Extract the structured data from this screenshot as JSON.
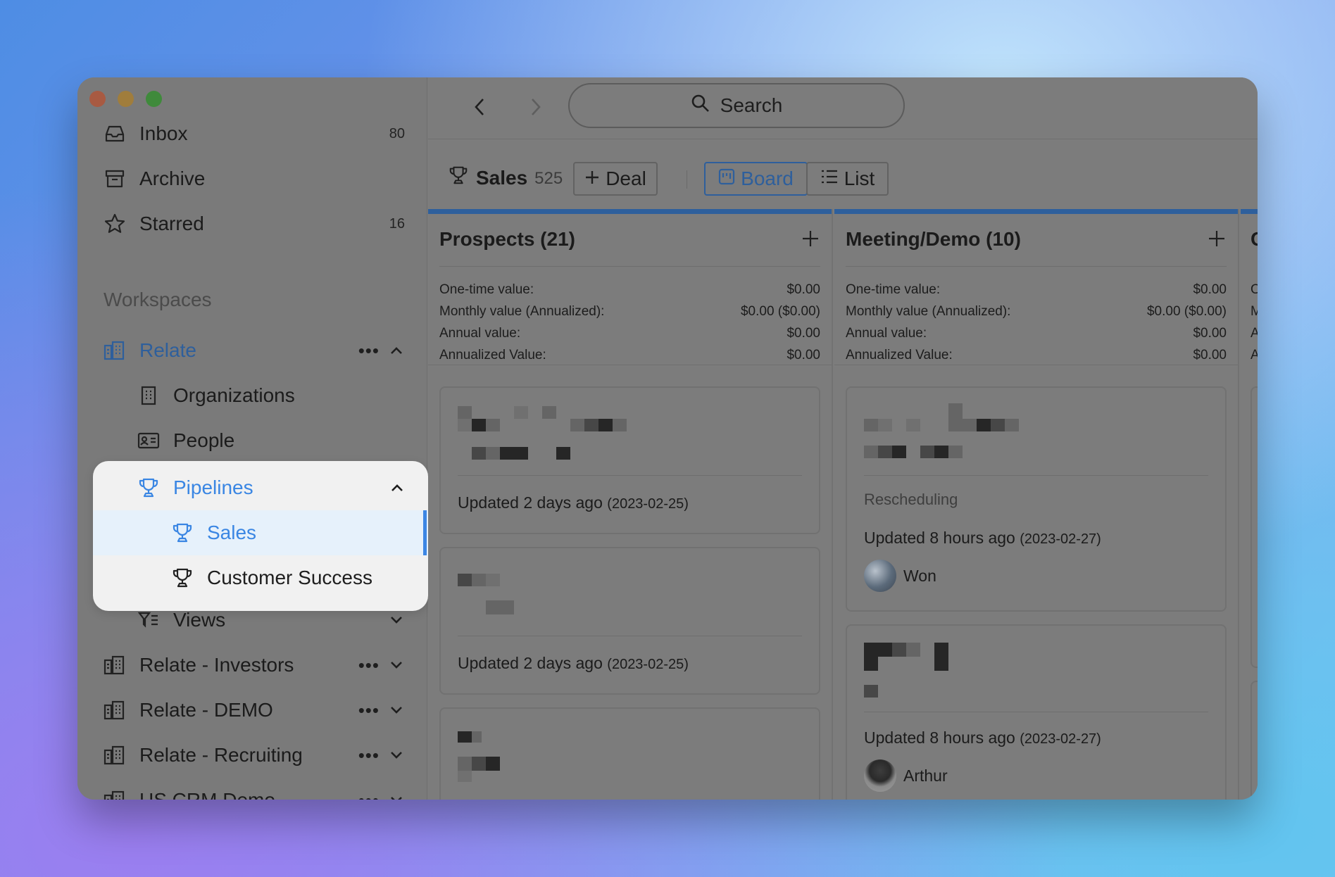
{
  "sidebar": {
    "nav": [
      {
        "label": "Inbox",
        "count": "80",
        "icon": "inbox-icon"
      },
      {
        "label": "Archive",
        "count": "",
        "icon": "archive-icon"
      },
      {
        "label": "Starred",
        "count": "16",
        "icon": "star-icon"
      }
    ],
    "workspaces_heading": "Workspaces",
    "workspace": {
      "label": "Relate",
      "more": "•••",
      "children": [
        "Organizations",
        "People"
      ],
      "pipelines": {
        "label": "Pipelines",
        "items": [
          "Sales",
          "Customer Success"
        ]
      },
      "views": "Views"
    },
    "other_workspaces": [
      "Relate - Investors",
      "Relate - DEMO",
      "Relate - Recruiting",
      "US CRM Demo"
    ]
  },
  "topbar": {
    "search_label": "Search"
  },
  "toolbar": {
    "title": "Sales",
    "count": "525",
    "add_deal": "Deal",
    "view_board": "Board",
    "view_list": "List"
  },
  "columns": [
    {
      "title": "Prospects (21)",
      "stats": [
        {
          "label": "One-time value:",
          "value": "$0.00"
        },
        {
          "label": "Monthly value (Annualized):",
          "value": "$0.00 ($0.00)"
        },
        {
          "label": "Annual value:",
          "value": "$0.00"
        },
        {
          "label": "Annualized Value:",
          "value": "$0.00"
        }
      ],
      "cards": [
        {
          "updated": "Updated 2 days ago",
          "date": "(2023-02-25)"
        },
        {
          "updated": "Updated 2 days ago",
          "date": "(2023-02-25)"
        }
      ]
    },
    {
      "title": "Meeting/Demo (10)",
      "stats": [
        {
          "label": "One-time value:",
          "value": "$0.00"
        },
        {
          "label": "Monthly value (Annualized):",
          "value": "$0.00 ($0.00)"
        },
        {
          "label": "Annual value:",
          "value": "$0.00"
        },
        {
          "label": "Annualized Value:",
          "value": "$0.00"
        }
      ],
      "cards": [
        {
          "tag": "Rescheduling",
          "updated": "Updated 8 hours ago",
          "date": "(2023-02-27)",
          "owner": "Won"
        },
        {
          "updated": "Updated 8 hours ago",
          "date": "(2023-02-27)",
          "owner": "Arthur"
        }
      ]
    }
  ],
  "next_column_initial": "C",
  "next_column_stat_initials": [
    "O",
    "M",
    "A",
    "A"
  ]
}
